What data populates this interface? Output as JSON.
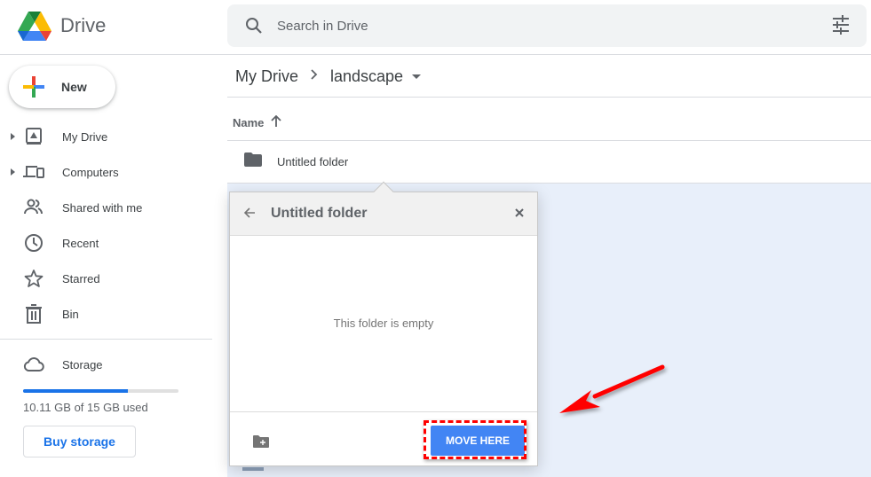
{
  "app": {
    "title": "Drive",
    "colors": {
      "accent": "#1a73e8",
      "move_button": "#4285f4",
      "annotation": "#ff0000",
      "selected_bg": "#e8effa"
    }
  },
  "search": {
    "placeholder": "Search in Drive",
    "value": "",
    "icon": "search-icon",
    "options_icon": "tune-icon"
  },
  "new_button": {
    "label": "New",
    "icon": "plus-icon"
  },
  "sidebar": {
    "items": [
      {
        "label": "My Drive",
        "icon": "my-drive-icon",
        "expandable": true
      },
      {
        "label": "Computers",
        "icon": "computers-icon",
        "expandable": true
      },
      {
        "label": "Shared with me",
        "icon": "shared-icon",
        "expandable": false
      },
      {
        "label": "Recent",
        "icon": "clock-icon",
        "expandable": false
      },
      {
        "label": "Starred",
        "icon": "star-icon",
        "expandable": false
      },
      {
        "label": "Bin",
        "icon": "trash-icon",
        "expandable": false
      }
    ],
    "storage": {
      "label": "Storage",
      "icon": "cloud-icon",
      "used_text": "10.11 GB of 15 GB used",
      "used_fraction": 0.674,
      "buy_label": "Buy storage"
    }
  },
  "breadcrumb": {
    "items": [
      "My Drive",
      "landscape"
    ],
    "separator": ">"
  },
  "file_list": {
    "column_header": "Name",
    "sort": "ascending",
    "rows": [
      {
        "name": "Untitled folder",
        "type": "folder"
      }
    ]
  },
  "move_dialog": {
    "title": "Untitled folder",
    "empty_message": "This folder is empty",
    "primary_button": "MOVE HERE",
    "back_icon": "arrow-left-icon",
    "close_icon": "close-icon",
    "new_folder_icon": "new-folder-icon"
  }
}
